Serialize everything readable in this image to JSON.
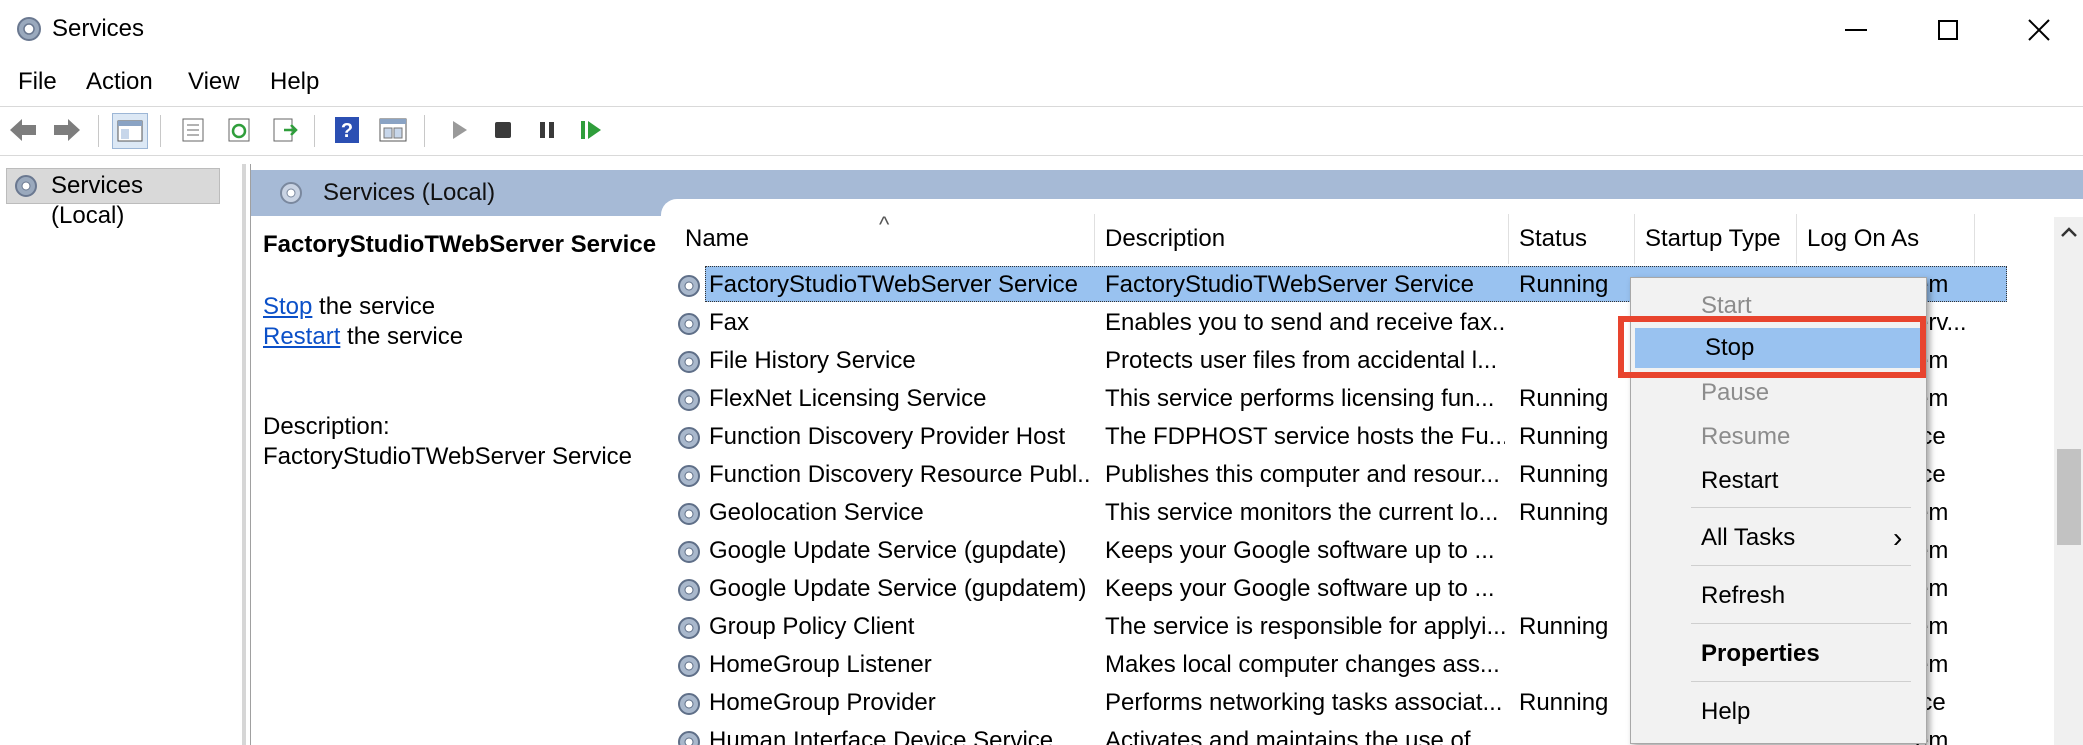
{
  "window": {
    "title": "Services",
    "controls": {
      "minimize": "—",
      "maximize": "☐",
      "close": "✕"
    }
  },
  "menu": [
    "File",
    "Action",
    "View",
    "Help"
  ],
  "tree": {
    "root_label": "Services (Local)"
  },
  "main_header": {
    "label": "Services (Local)"
  },
  "extended": {
    "title": "FactoryStudioTWebServer Service",
    "stop_link": "Stop",
    "stop_suffix": " the service",
    "restart_link": "Restart",
    "restart_suffix": " the service",
    "description_label": "Description:",
    "description_value": "FactoryStudioTWebServer Service"
  },
  "columns": {
    "name": "Name",
    "description": "Description",
    "status": "Status",
    "startup_type": "Startup Type",
    "log_on_as": "Log On As",
    "sort_indicator": "^"
  },
  "rows": [
    {
      "name": "FactoryStudioTWebServer Service",
      "description": "FactoryStudioTWebServer Service",
      "status": "Running",
      "startup": "",
      "logon": "em",
      "selected": true
    },
    {
      "name": "Fax",
      "description": "Enables you to send and receive fax...",
      "status": "",
      "startup": "",
      "logon": "erv..."
    },
    {
      "name": "File History Service",
      "description": "Protects user files from accidental l...",
      "status": "",
      "startup": "",
      "logon": "em"
    },
    {
      "name": "FlexNet Licensing Service",
      "description": "This service performs licensing fun...",
      "status": "Running",
      "startup": "",
      "logon": "em"
    },
    {
      "name": "Function Discovery Provider Host",
      "description": "The FDPHOST service hosts the Fu...",
      "status": "Running",
      "startup": "",
      "logon": "ice"
    },
    {
      "name": "Function Discovery Resource Publ...",
      "description": "Publishes this computer and resour...",
      "status": "Running",
      "startup": "",
      "logon": "ice"
    },
    {
      "name": "Geolocation Service",
      "description": "This service monitors the current lo...",
      "status": "Running",
      "startup": "",
      "logon": "em"
    },
    {
      "name": "Google Update Service (gupdate)",
      "description": "Keeps your Google software up to ...",
      "status": "",
      "startup": "",
      "logon": "em"
    },
    {
      "name": "Google Update Service (gupdatem)",
      "description": "Keeps your Google software up to ...",
      "status": "",
      "startup": "",
      "logon": "em"
    },
    {
      "name": "Group Policy Client",
      "description": "The service is responsible for applyi...",
      "status": "Running",
      "startup": "",
      "logon": "em"
    },
    {
      "name": "HomeGroup Listener",
      "description": "Makes local computer changes ass...",
      "status": "",
      "startup": "",
      "logon": "em"
    },
    {
      "name": "HomeGroup Provider",
      "description": "Performs networking tasks associat...",
      "status": "Running",
      "startup": "",
      "logon": "ice"
    },
    {
      "name": "Human Interface Device Service",
      "description": "Activates and maintains the use of ...",
      "status": "",
      "startup": "",
      "logon": "em"
    }
  ],
  "context_menu": {
    "start": "Start",
    "stop": "Stop",
    "pause": "Pause",
    "resume": "Resume",
    "restart": "Restart",
    "all_tasks": "All Tasks",
    "all_tasks_arrow": "›",
    "refresh": "Refresh",
    "properties": "Properties",
    "help": "Help"
  },
  "colors": {
    "header_blue": "#a6bad6",
    "selection": "#99c2f0",
    "highlight_box": "#e8442e",
    "link": "#0b50c8"
  },
  "icons": {
    "app": "gear-icon",
    "toolbar": [
      "back-arrow-icon",
      "forward-arrow-icon",
      "show-hide-tree-icon",
      "export-list-icon",
      "refresh-icon",
      "export-icon",
      "help-icon",
      "properties-icon",
      "start-icon",
      "stop-icon",
      "pause-icon",
      "restart-icon"
    ]
  },
  "scrollbar": {
    "up_arrow": "⌃"
  }
}
